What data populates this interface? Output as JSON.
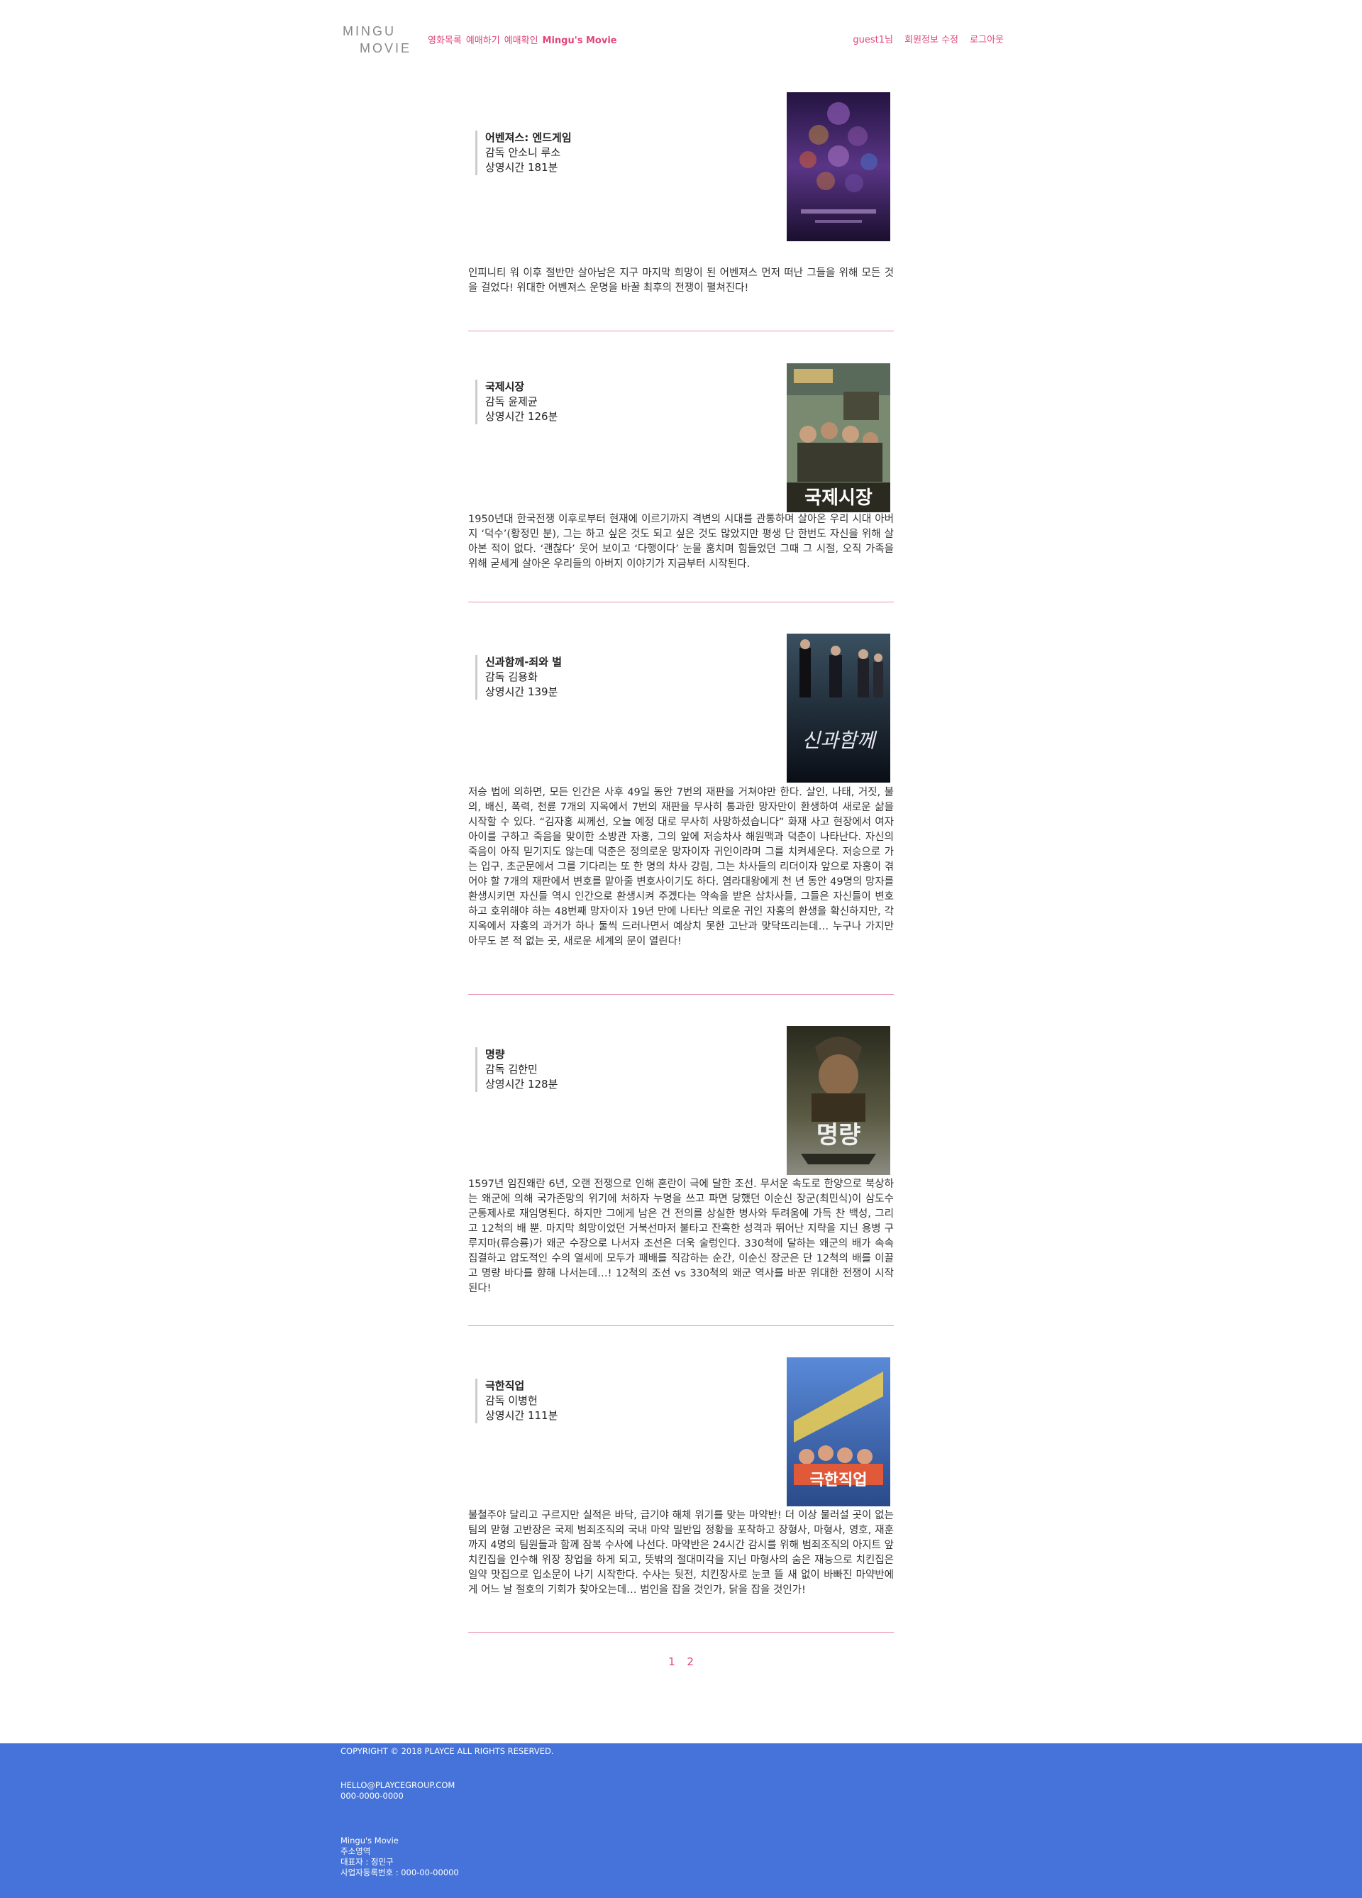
{
  "header": {
    "logo_line1": "MINGU",
    "logo_line2": "MOVIE",
    "nav": [
      "영화목록",
      "예매하기",
      "예매확인"
    ],
    "brand": "Mingu's Movie",
    "user": "guest1님",
    "edit_profile": "회원정보 수정",
    "logout": "로그아웃"
  },
  "movies": [
    {
      "title": "어벤져스: 엔드게임",
      "director": "감독 안소니 루소",
      "runtime": "상영시간 181분",
      "description": "인피니티 워 이후 절반만 살아남은 지구 마지막 희망이 된 어벤져스 먼저 떠난 그들을 위해 모든 것을 걸었다! 위대한 어벤져스 운명을 바꿀 최후의 전쟁이 펼쳐진다!",
      "poster_colors": [
        "#2a1a4a",
        "#6a3a8a",
        "#c86a3a"
      ]
    },
    {
      "title": "국제시장",
      "director": "감독 윤제균",
      "runtime": "상영시간 126분",
      "description": "1950년대 한국전쟁 이후로부터 현재에 이르기까지 격변의 시대를 관통하며 살아온 우리 시대 아버지 ‘덕수’(황정민 분), 그는 하고 싶은 것도 되고 싶은 것도 많았지만 평생 단 한번도 자신을 위해 살아본 적이 없다. ‘괜찮다’ 웃어 보이고 ‘다행이다’ 눈물 훔치며 힘들었던 그때 그 시절, 오직 가족을 위해 굳세게 살아온 우리들의 아버지 이야기가 지금부터 시작된다.",
      "poster_text": "국제시장",
      "poster_colors": [
        "#6a7a6a",
        "#9aa08a",
        "#3a3a2a"
      ]
    },
    {
      "title": "신과함께-죄와 벌",
      "director": "감독 김용화",
      "runtime": "상영시간 139분",
      "description": "저승 법에 의하면, 모든 인간은 사후 49일 동안 7번의 재판을 거쳐야만 한다. 살인, 나태, 거짓, 불의, 배신, 폭력, 천륜 7개의 지옥에서 7번의 재판을 무사히 통과한 망자만이 환생하여 새로운 삶을 시작할 수 있다. “김자홍 씨께선, 오늘 예정 대로 무사히 사망하셨습니다” 화재 사고 현장에서 여자아이를 구하고 죽음을 맞이한 소방관 자홍, 그의 앞에 저승차사 해원맥과 덕춘이 나타난다. 자신의 죽음이 아직 믿기지도 않는데 덕춘은 정의로운 망자이자 귀인이라며 그를 치켜세운다. 저승으로 가는 입구, 초군문에서 그를 기다리는 또 한 명의 차사 강림, 그는 차사들의 리더이자 앞으로 자홍이 겪어야 할 7개의 재판에서 변호를 맡아줄 변호사이기도 하다. 염라대왕에게 천 년 동안 49명의 망자를 환생시키면 자신들 역시 인간으로 환생시켜 주겠다는 약속을 받은 삼차사들, 그들은 자신들이 변호하고 호위해야 하는 48번째 망자이자 19년 만에 나타난 의로운 귀인 자홍의 환생을 확신하지만, 각 지옥에서 자홍의 과거가 하나 둘씩 드러나면서 예상치 못한 고난과 맞닥뜨리는데… 누구나 가지만 아무도 본 적 없는 곳, 새로운 세계의 문이 열린다!",
      "poster_text": "신과함께",
      "poster_colors": [
        "#1a2a3a",
        "#4a6a7a",
        "#0a0a14"
      ]
    },
    {
      "title": "명량",
      "director": "감독 김한민",
      "runtime": "상영시간 128분",
      "description": "1597년 임진왜란 6년, 오랜 전쟁으로 인해 혼란이 극에 달한 조선. 무서운 속도로 한양으로 북상하는 왜군에 의해 국가존망의 위기에 처하자 누명을 쓰고 파면 당했던 이순신 장군(최민식)이 삼도수군통제사로 재임명된다. 하지만 그에게 남은 건 전의를 상실한 병사와 두려움에 가득 찬 백성, 그리고 12척의 배 뿐. 마지막 희망이었던 거북선마저 불타고 잔혹한 성격과 뛰어난 지략을 지닌 용병 구루지마(류승룡)가 왜군 수장으로 나서자 조선은 더욱 술렁인다. 330척에 달하는 왜군의 배가 속속 집결하고 압도적인 수의 열세에 모두가 패배를 직감하는 순간, 이순신 장군은 단 12척의 배를 이끌고 명량 바다를 향해 나서는데…! 12척의 조선 vs 330척의 왜군 역사를 바꾼 위대한 전쟁이 시작된다!",
      "poster_text": "명량",
      "poster_colors": [
        "#3a3a2a",
        "#6a6a4a",
        "#1a1a14"
      ]
    },
    {
      "title": "극한직업",
      "director": "감독 이병헌",
      "runtime": "상영시간 111분",
      "description": "불철주야 달리고 구르지만 실적은 바닥, 급기야 해체 위기를 맞는 마약반! 더 이상 물러설 곳이 없는 팀의 맏형 고반장은 국제 범죄조직의 국내 마약 밀반입 정황을 포착하고 장형사, 마형사, 영호, 재훈까지 4명의 팀원들과 함께 잠복 수사에 나선다. 마약반은 24시간 감시를 위해 범죄조직의 아지트 앞 치킨집을 인수해 위장 창업을 하게 되고, 뜻밖의 절대미각을 지닌 마형사의 숨은 재능으로 치킨집은 일약 맛집으로 입소문이 나기 시작한다. 수사는 뒷전, 치킨장사로 눈코 뜰 새 없이 바빠진 마약반에게 어느 날 절호의 기회가 찾아오는데… 범인을 잡을 것인가, 닭을 잡을 것인가!",
      "poster_text": "극한직업",
      "poster_colors": [
        "#4a7ac8",
        "#e05a4a",
        "#f0c040"
      ]
    }
  ],
  "pagination": [
    "1",
    "2"
  ],
  "footer": {
    "copyright": "COPYRIGHT © 2018 PLAYCE ALL RIGHTS RESERVED.",
    "email": "HELLO@PLAYCEGROUP.COM",
    "phone": "000-0000-0000",
    "company": "Mingu's Movie",
    "address": "주소영역",
    "ceo": "대표자 : 정민구",
    "biz_no": "사업자등록번호 : 000-00-00000"
  }
}
